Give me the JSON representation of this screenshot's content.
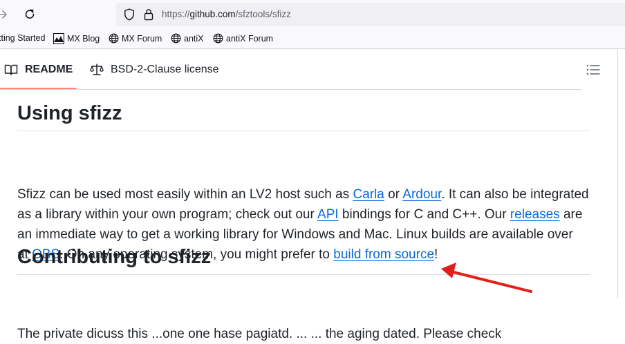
{
  "browser": {
    "url_prefix": "https://",
    "url_host": "github.com",
    "url_path": "/sfztools/sfizz",
    "bookmarks": [
      {
        "label": "tting Started",
        "icon": "none"
      },
      {
        "label": "MX Blog",
        "icon": "mx-logo-icon"
      },
      {
        "label": "MX Forum",
        "icon": "globe-icon"
      },
      {
        "label": "antiX",
        "icon": "globe-icon"
      },
      {
        "label": "antiX Forum",
        "icon": "globe-icon"
      }
    ]
  },
  "readme": {
    "tabs": [
      {
        "label": "README",
        "icon": "book-icon",
        "active": true
      },
      {
        "label": "BSD-2-Clause license",
        "icon": "law-icon",
        "active": false
      }
    ],
    "heading_using": "Using sfizz",
    "paragraph": {
      "l1_a": "Sfizz can be used most easily within an LV2 host such as ",
      "l1_link1": "Carla",
      "l1_b": " or ",
      "l1_link2": "Ardour",
      "l1_c": ". It can also be integrated",
      "l2_a": "as a library within your own program; check out our ",
      "l2_link1": "API",
      "l2_b": " bindings for C and C++. Our ",
      "l2_link2": "releases",
      "l2_c": " are",
      "l3": "an immediate way to get a working library for Windows and Mac. Linux builds are available over",
      "l4_a": "at ",
      "l4_link1": "OBS",
      "l4_b": ". On any operating system, you might prefer to ",
      "l4_link2": "build from source",
      "l4_c": "!"
    },
    "heading_contrib": "Contributing to sfizz",
    "cut_text": "The private dicuss this ...one one hase pagiatd. ... ... the aging dated. Please check"
  },
  "colors": {
    "link": "#0969da",
    "annotation_arrow": "#e0211b",
    "tab_underline": "#fd8c73"
  }
}
